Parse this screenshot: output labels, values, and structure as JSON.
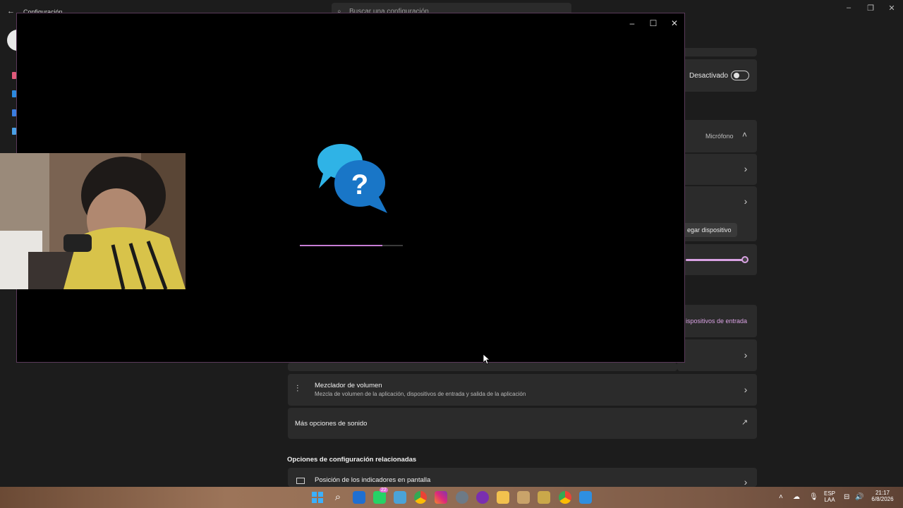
{
  "background_app": {
    "title": "Configuración",
    "search_placeholder": "Buscar una configuración",
    "toggle_label": "Desactivado",
    "microphone_label": "Micrófono",
    "add_device_label": "egar dispositivo",
    "input_devices_link": "ispositivos de entrada",
    "mixer": {
      "title": "Mezclador de volumen",
      "subtitle": "Mezcla de volumen de la aplicación, dispositivos de entrada y salida de la aplicación"
    },
    "more_sound": "Más opciones de sonido",
    "related_header": "Opciones de configuración relacionadas",
    "indicator_position": "Posición de los indicadores en pantalla",
    "volume_level": 0.95
  },
  "help_window": {
    "loading_progress": 0.8,
    "icon": "get-help-icon",
    "accent": "#c77dd4"
  },
  "taskbar": {
    "whatsapp_badge": "22",
    "lang_top": "ESP",
    "lang_bottom": "LAA",
    "time": "21:17",
    "date": "6/8/2026"
  },
  "colors": {
    "accent": "#d9a2e3",
    "bubble_light": "#2fb3e6",
    "bubble_dark": "#1976c7"
  }
}
